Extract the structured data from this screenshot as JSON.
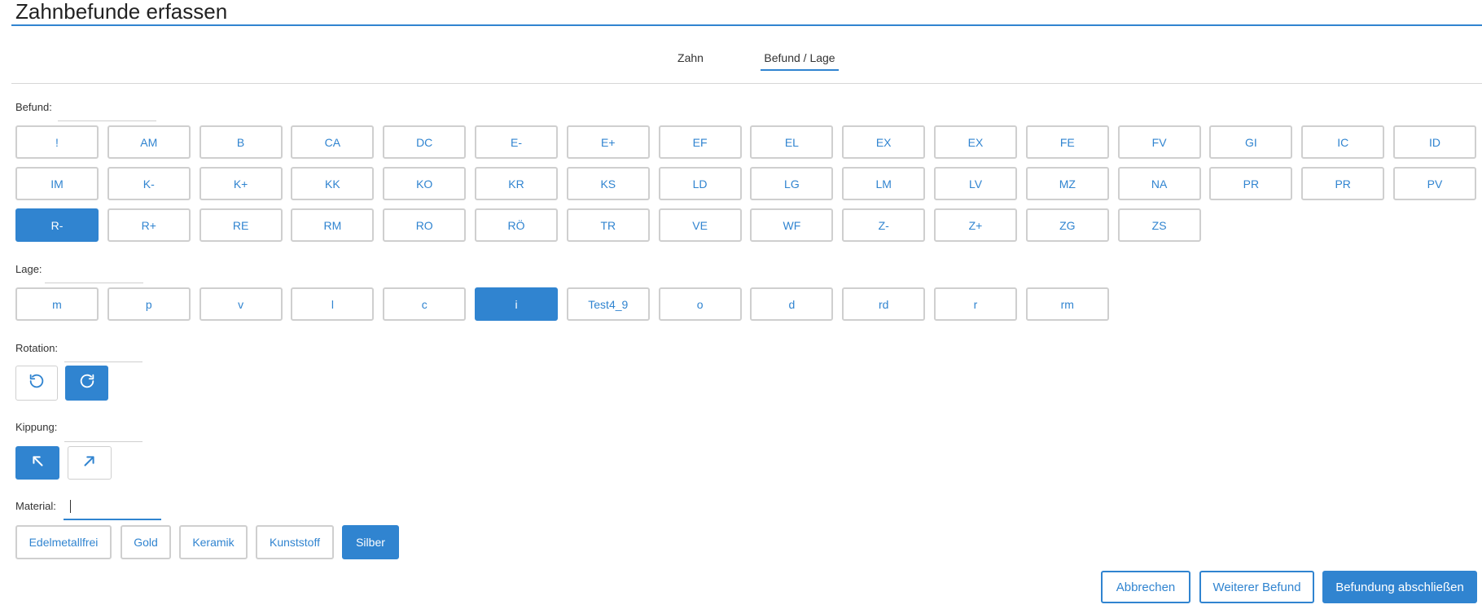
{
  "title": "Zahnbefunde erfassen",
  "tabs": {
    "zahn": "Zahn",
    "befund_lage": "Befund / Lage"
  },
  "befund": {
    "label": "Befund:",
    "options": [
      "!",
      "AM",
      "B",
      "CA",
      "DC",
      "E-",
      "E+",
      "EF",
      "EL",
      "EX",
      "EX",
      "FE",
      "FV",
      "GI",
      "IC",
      "ID",
      "IM",
      "K-",
      "K+",
      "KK",
      "KO",
      "KR",
      "KS",
      "LD",
      "LG",
      "LM",
      "LV",
      "MZ",
      "NA",
      "PR",
      "PR",
      "PV",
      "R-",
      "R+",
      "RE",
      "RM",
      "RO",
      "RÖ",
      "TR",
      "VE",
      "WF",
      "Z-",
      "Z+",
      "ZG",
      "ZS"
    ],
    "selected": "R-"
  },
  "lage": {
    "label": "Lage:",
    "options": [
      "m",
      "p",
      "v",
      "l",
      "c",
      "i",
      "Test4_9",
      "o",
      "d",
      "rd",
      "r",
      "rm"
    ],
    "selected": "i"
  },
  "rotation": {
    "label": "Rotation:",
    "ccw_icon": "rotate-ccw-icon",
    "cw_icon": "rotate-cw-icon",
    "selected": "cw"
  },
  "kippung": {
    "label": "Kippung:",
    "left_icon": "arrow-up-left-icon",
    "right_icon": "arrow-up-right-icon",
    "selected": "left"
  },
  "material": {
    "label": "Material:",
    "value": "",
    "options": [
      "Edelmetallfrei",
      "Gold",
      "Keramik",
      "Kunststoff",
      "Silber"
    ],
    "selected": "Silber"
  },
  "footer": {
    "cancel": "Abbrechen",
    "more": "Weiterer Befund",
    "finish": "Befundung abschließen"
  },
  "colors": {
    "accent": "#3084d0",
    "border": "#cfcfcf"
  }
}
